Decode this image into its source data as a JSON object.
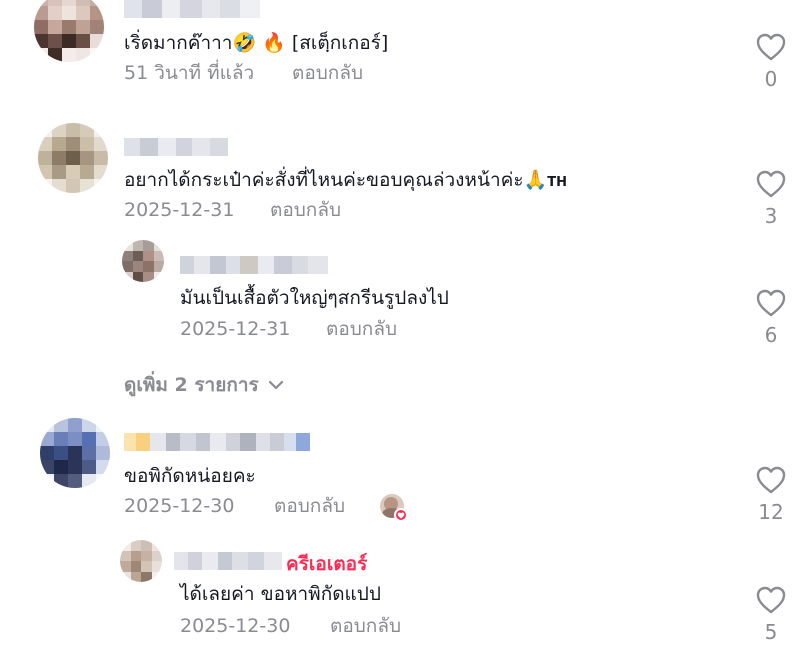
{
  "comments": [
    {
      "text": "เริ่ดมากค๊าาา",
      "emoji_tail": "🤣 🔥",
      "sticker": "[สเตฺ็กเกอร์]",
      "time": "51 วินาที ที่แล้ว",
      "reply_label": "ตอบกลับ",
      "likes": "0"
    },
    {
      "text": "อยากได้กระเป๋าค่ะสั่งที่ไหนค่ะขอบคุณล่วงหน้าค่ะ",
      "emoji_tail": "🙏",
      "lang_tag": "TH",
      "time": "2025-12-31",
      "reply_label": "ตอบกลับ",
      "likes": "3"
    },
    {
      "text": "มันเป็นเสื้อตัวใหญ่ๆสกรีนรูปลงไป",
      "time": "2025-12-31",
      "reply_label": "ตอบกลับ",
      "likes": "6"
    },
    {
      "text": "ขอพิกัดหน่อยคะ",
      "time": "2025-12-30",
      "reply_label": "ตอบกลับ",
      "likes": "12"
    },
    {
      "creator_label": "ครีเอเตอร์",
      "text": "ได้เลยค่า ขอหาพิกัดแปป",
      "time": "2025-12-30",
      "reply_label": "ตอบกลับ",
      "likes": "5"
    }
  ],
  "view_more": "ดูเพิ่ม 2 รายการ",
  "colors": {
    "accent": "#fe2c55",
    "muted": "#8a8b91",
    "text": "#161823"
  },
  "icons": {
    "like": "heart-outline-icon",
    "expand": "chevron-down-icon",
    "liked_by_creator": "creator-liked-avatar-icon"
  }
}
